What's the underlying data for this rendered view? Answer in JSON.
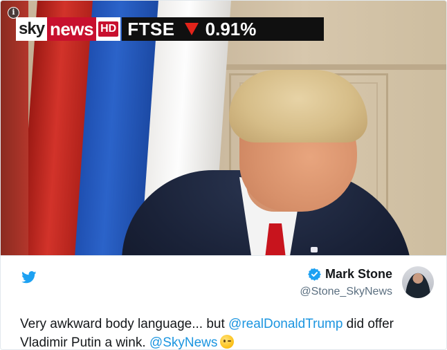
{
  "video": {
    "channel_logo_sky": "sky",
    "channel_logo_news": "news",
    "channel_logo_hd": "HD",
    "ticker_name": "FTSE",
    "ticker_direction": "down",
    "ticker_value": "0.91%",
    "info_symbol": "i"
  },
  "tweet": {
    "display_name": "Mark Stone",
    "handle": "@Stone_SkyNews",
    "verified": true,
    "text_before": "Very awkward body language... but ",
    "mention_1": "@realDonaldTrump",
    "text_middle": " did offer Vladimir Putin a wink. ",
    "mention_2": "@SkyNews",
    "emoji": "winking-face"
  },
  "colors": {
    "link": "#1b95e0",
    "twitter_blue": "#1da1f2",
    "sky_red": "#c8102e",
    "ticker_down": "#e2231a"
  }
}
